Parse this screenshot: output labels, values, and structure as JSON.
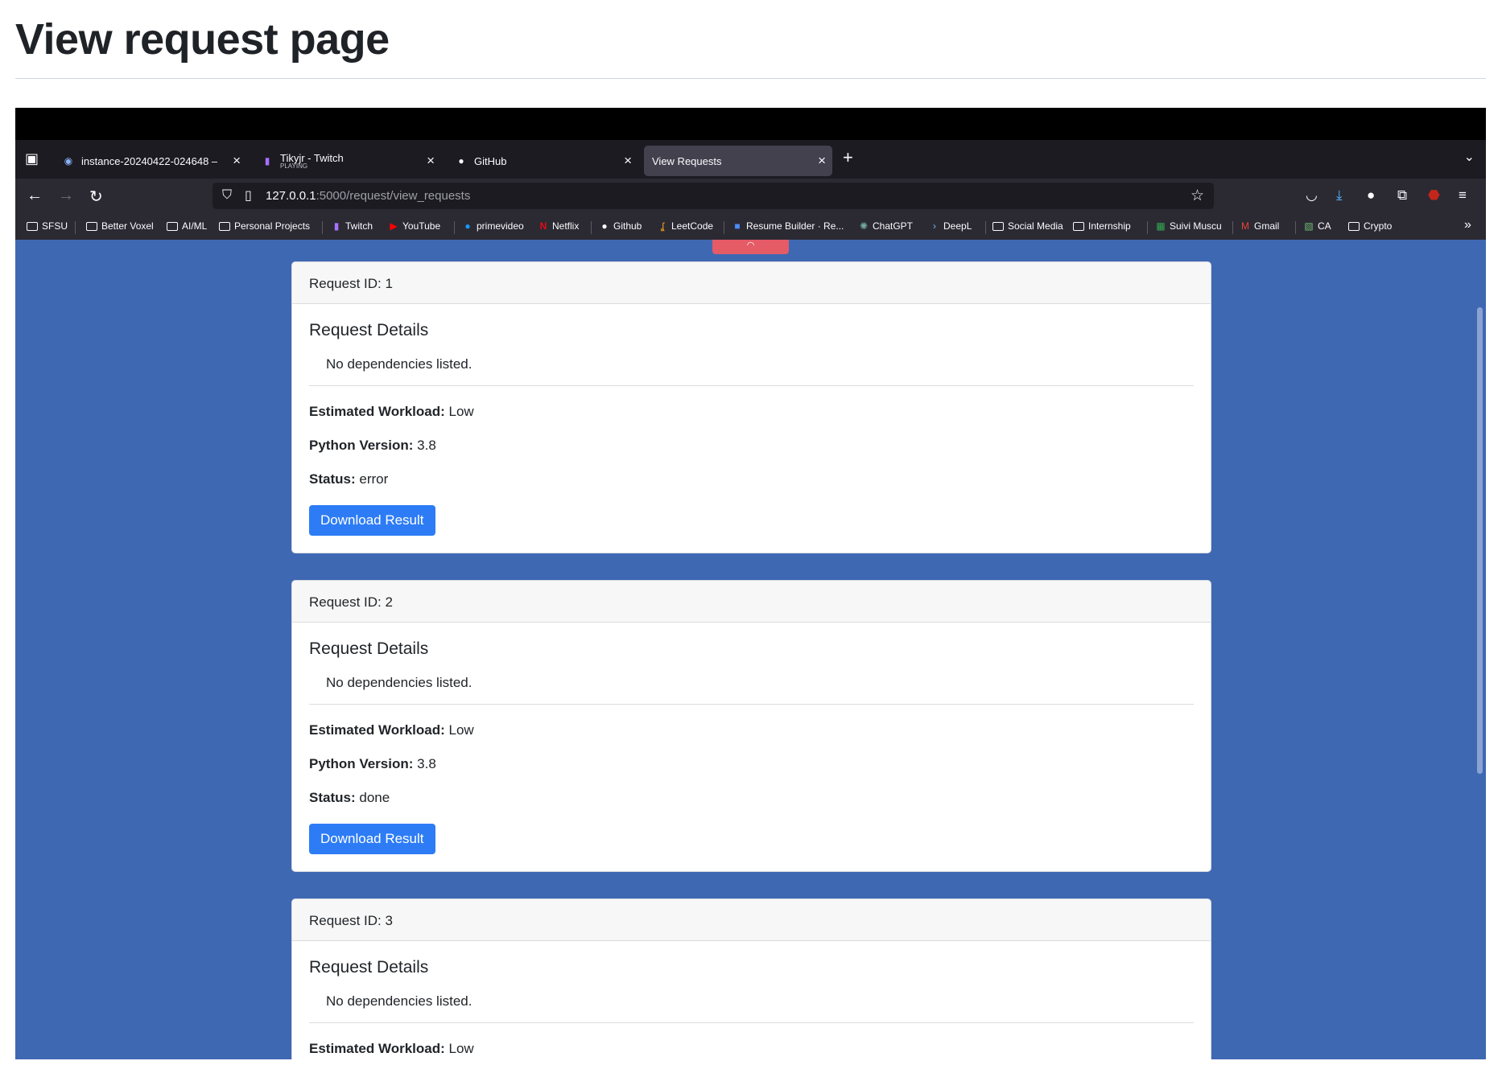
{
  "doc": {
    "title": "View request page"
  },
  "browser": {
    "tabs": [
      {
        "title": "instance-20240422-024648 – ",
        "subtitle": ""
      },
      {
        "title": "Tikyjr - Twitch",
        "subtitle": "PLAYING"
      },
      {
        "title": "GitHub",
        "subtitle": ""
      },
      {
        "title": "View Requests",
        "subtitle": ""
      }
    ],
    "new_tab": "+",
    "url_host": "127.0.0.1",
    "url_rest": ":5000/request/view_requests",
    "bookmarks": [
      "SFSU",
      "Better Voxel",
      "AI/ML",
      "Personal Projects",
      "Twitch",
      "YouTube",
      "primevideo",
      "Netflix",
      "Github",
      "LeetCode",
      "Resume Builder · Re...",
      "ChatGPT",
      "DeepL",
      "Social Media",
      "Internship",
      "Suivi Muscu",
      "Gmail",
      "CA",
      "Crypto"
    ],
    "icons": {
      "back": "arrow-left-icon",
      "forward": "arrow-right-icon",
      "reload": "reload-icon",
      "pocket": "pocket-icon",
      "downloads": "download-icon",
      "account": "account-icon",
      "extensions": "puzzle-icon",
      "ublock": "ublock-icon",
      "menu": "hamburger-menu-icon"
    }
  },
  "requests": [
    {
      "header": "Request ID: 1",
      "title": "Request Details",
      "deps": "No dependencies listed.",
      "workload_label": "Estimated Workload:",
      "workload": "Low",
      "python_label": "Python Version:",
      "python": "3.8",
      "status_label": "Status:",
      "status": "error",
      "button": "Download Result"
    },
    {
      "header": "Request ID: 2",
      "title": "Request Details",
      "deps": "No dependencies listed.",
      "workload_label": "Estimated Workload:",
      "workload": "Low",
      "python_label": "Python Version:",
      "python": "3.8",
      "status_label": "Status:",
      "status": "done",
      "button": "Download Result"
    },
    {
      "header": "Request ID: 3",
      "title": "Request Details",
      "deps": "No dependencies listed.",
      "workload_label": "Estimated Workload:",
      "workload": "Low"
    }
  ],
  "colors": {
    "page_bg": "#3f68b3",
    "button": "#2d7cf6",
    "top_red_button": "#e55b66"
  }
}
